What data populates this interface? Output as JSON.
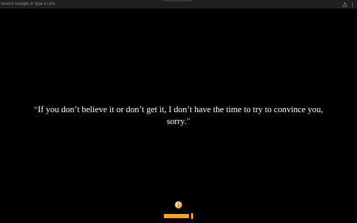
{
  "browser": {
    "omnibox_placeholder": "Search Google or type a URL",
    "toolbar_icons": [
      "share-icon",
      "menu-icon"
    ]
  },
  "quote": {
    "open_mark": "“",
    "text": "If you don’t believe it or don’t get it, I don’t have the time to try to convince you, sorry.",
    "close_mark": "”"
  },
  "footer": {
    "progress_fraction": 1.0
  },
  "colors": {
    "background": "#000000",
    "quote_text": "#ffffff",
    "accent": "#f5a31a"
  }
}
